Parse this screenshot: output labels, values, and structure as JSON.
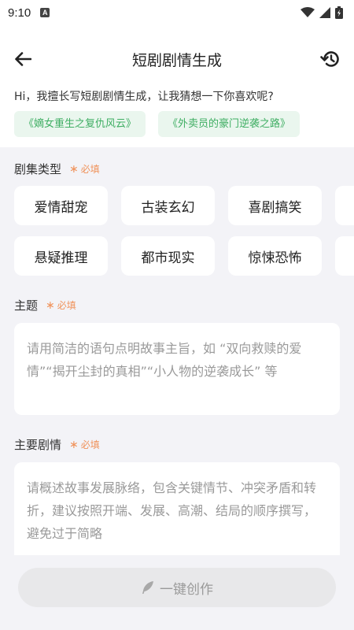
{
  "status": {
    "time": "9:10",
    "notif_letter": "A"
  },
  "header": {
    "title": "短剧剧情生成"
  },
  "greeting": "Hi，我擅长写短剧剧情生成，让我猜想一下你喜欢呢?",
  "suggestions": [
    "《嫡女重生之复仇风云》",
    "《外卖员的豪门逆袭之路》"
  ],
  "genre": {
    "label": "剧集类型",
    "required": "必填",
    "row1": [
      "爱情甜宠",
      "古装玄幻",
      "喜剧搞笑"
    ],
    "row2": [
      "悬疑推理",
      "都市现实",
      "惊悚恐怖"
    ]
  },
  "theme": {
    "label": "主题",
    "required": "必填",
    "placeholder": "请用简洁的语句点明故事主旨，如 “双向救赎的爱情”“揭开尘封的真相”“小人物的逆袭成长” 等"
  },
  "plot": {
    "label": "主要剧情",
    "required": "必填",
    "placeholder": "请概述故事发展脉络，包含关键情节、冲突矛盾和转折，建议按照开端、发展、高潮、结局的顺序撰写，避免过于简略"
  },
  "create_button": {
    "label": "一键创作"
  },
  "colors": {
    "accent_green": "#3fae63",
    "required_orange": "#f0925a",
    "panel_bg": "#f3f3f7"
  }
}
